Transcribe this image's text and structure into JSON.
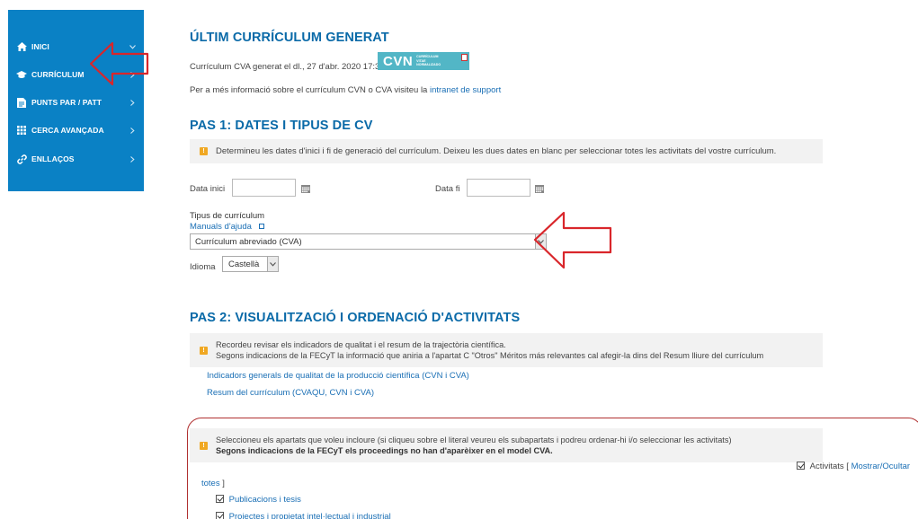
{
  "sidebar": {
    "items": [
      {
        "label": "INICI",
        "icon": "home-icon",
        "chevron": "chevron-down"
      },
      {
        "label": "CURRÍCULUM",
        "icon": "graduation-cap-icon",
        "chevron": "chevron-right"
      },
      {
        "label": "PUNTS PAR / PATT",
        "icon": "document-icon",
        "chevron": "chevron-right"
      },
      {
        "label": "CERCA AVANÇADA",
        "icon": "grid-icon",
        "chevron": "chevron-right"
      },
      {
        "label": "ENLLAÇOS",
        "icon": "link-icon",
        "chevron": "chevron-right"
      }
    ],
    "bg_color": "#0a81c5"
  },
  "header": {
    "title": "ÚLTIM CURRÍCULUM GENERAT",
    "generated_text": "Currículum CVA generat el dl., 27 d'abr. 2020 17:33.",
    "logo_text": "CVN",
    "logo_small_text": "CURRÍCULUM VITAE NORMALIZADO",
    "info_prefix": "Per a més informació sobre el currículum CVN o CVA visiteu la",
    "info_link": "intranet de support"
  },
  "step1": {
    "title": "PAS 1: DATES I TIPUS DE CV",
    "notice": "Determineu les dates d'inici i fi de generació del currículum. Deixeu les dues dates en blanc per seleccionar totes les activitats del vostre currículum.",
    "start_label": "Data inici",
    "start_value": "",
    "end_label": "Data fi",
    "end_value": "",
    "type_label": "Tipus de currículum",
    "help_link": "Manuals d'ajuda",
    "type_value": "Currículum abreviado (CVA)",
    "lang_label": "Idioma",
    "lang_value": "Castellà"
  },
  "step2": {
    "title": "PAS 2: VISUALITZACIÓ I ORDENACIÓ D'ACTIVITATS",
    "notice_line1": "Recordeu revisar els indicadors de qualitat i el resum de la trajectòria científica.",
    "notice_line2": "Segons indicacions de la FECyT la informació que aniria a l'apartat C \"Otros\" Méritos más relevantes cal afegir-la dins del Resum lliure del currículum",
    "link1": "Indicadors generals de qualitat de la producció científica (CVN i CVA)",
    "link2": "Resum del currículum (CVAQU, CVN i CVA)",
    "sections_notice_line1": "Seleccioneu els apartats que voleu incloure (si cliqueu sobre el literal veureu els subapartats i podreu ordenar-hi i/o seleccionar les activitats)",
    "sections_notice_line2": "Segons indicacions de la FECyT els proceedings no han d'aparèixer en el model CVA.",
    "activitats_label": "Activitats",
    "toggle_open": "[",
    "toggle_link": "Mostrar/Ocultar",
    "toggle_rest": "totes",
    "toggle_close": "]",
    "items": [
      "Publicacions i tesis",
      "Projectes i propietat intel·lectual i industrial"
    ]
  }
}
